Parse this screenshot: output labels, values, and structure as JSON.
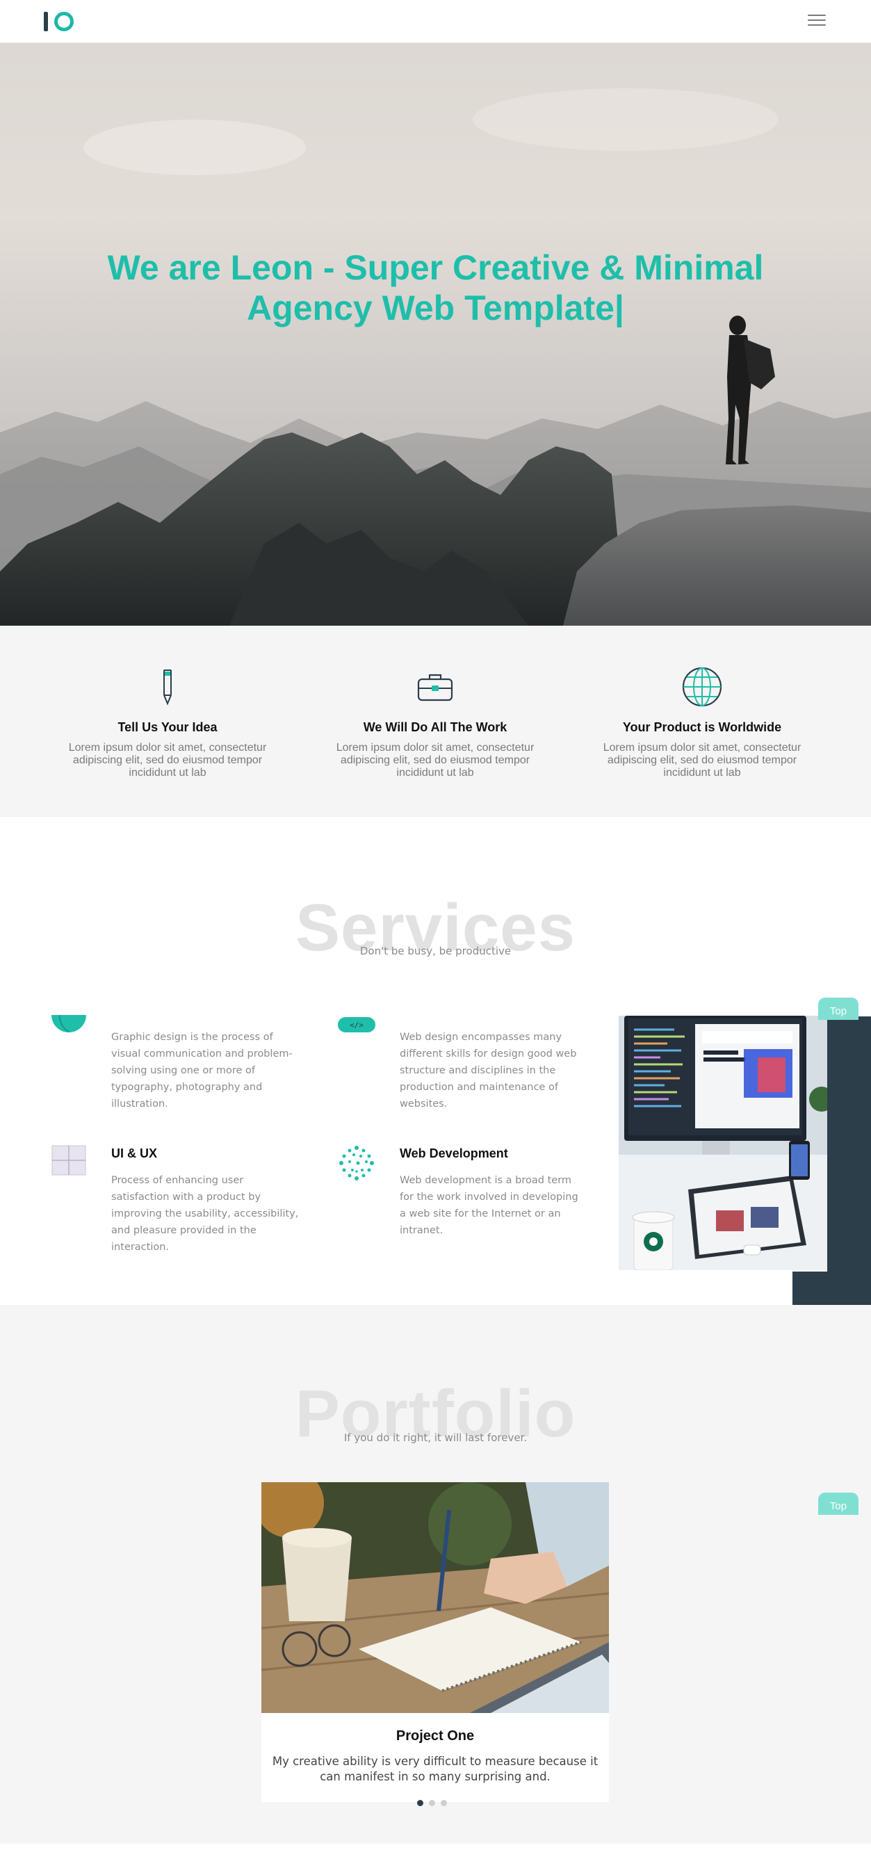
{
  "brand": {
    "logo_letters": "IO",
    "accent": "#1ebeaa",
    "dark": "#2c3e4a"
  },
  "header": {
    "menu_icon": "hamburger-menu-icon"
  },
  "hero": {
    "title": "We are Leon - Super Creative & Minimal Agency Web Template|"
  },
  "features": [
    {
      "icon": "pencil-icon",
      "title": "Tell Us Your Idea",
      "text": "Lorem ipsum dolor sit amet, consectetur adipiscing elit, sed do eiusmod tempor incididunt ut lab"
    },
    {
      "icon": "briefcase-icon",
      "title": "We Will Do All The Work",
      "text": "Lorem ipsum dolor sit amet, consectetur adipiscing elit, sed do eiusmod tempor incididunt ut lab"
    },
    {
      "icon": "globe-icon",
      "title": "Your Product is Worldwide",
      "text": "Lorem ipsum dolor sit amet, consectetur adipiscing elit, sed do eiusmod tempor incididunt ut lab"
    }
  ],
  "services": {
    "heading": "Services",
    "subheading": "Don't be busy, be productive",
    "items": [
      {
        "icon": "globe-icon",
        "title": "",
        "text": "Graphic design is the process of visual communication and problem-solving using one or more of typography, photography and illustration."
      },
      {
        "icon": "code-icon",
        "title": "",
        "text": "Web design encompasses many different skills for design good web structure and disciplines in the production and maintenance of websites."
      },
      {
        "icon": "layout-icon",
        "title": "UI & UX",
        "text": "Process of enhancing user satisfaction with a product by improving the usability, accessibility, and pleasure provided in the interaction."
      },
      {
        "icon": "dots-network-icon",
        "title": "Web Development",
        "text": "Web development is a broad term for the work involved in developing a web site for the Internet or an intranet."
      }
    ],
    "top_label": "Top"
  },
  "portfolio": {
    "heading": "Portfolio",
    "subheading": "If you do it right, it will last forever.",
    "card": {
      "title": "Project One",
      "text": "My creative ability is very difficult to measure because it can manifest in so many surprising and."
    },
    "top_label": "Top",
    "pages": 3,
    "active_page": 1
  }
}
